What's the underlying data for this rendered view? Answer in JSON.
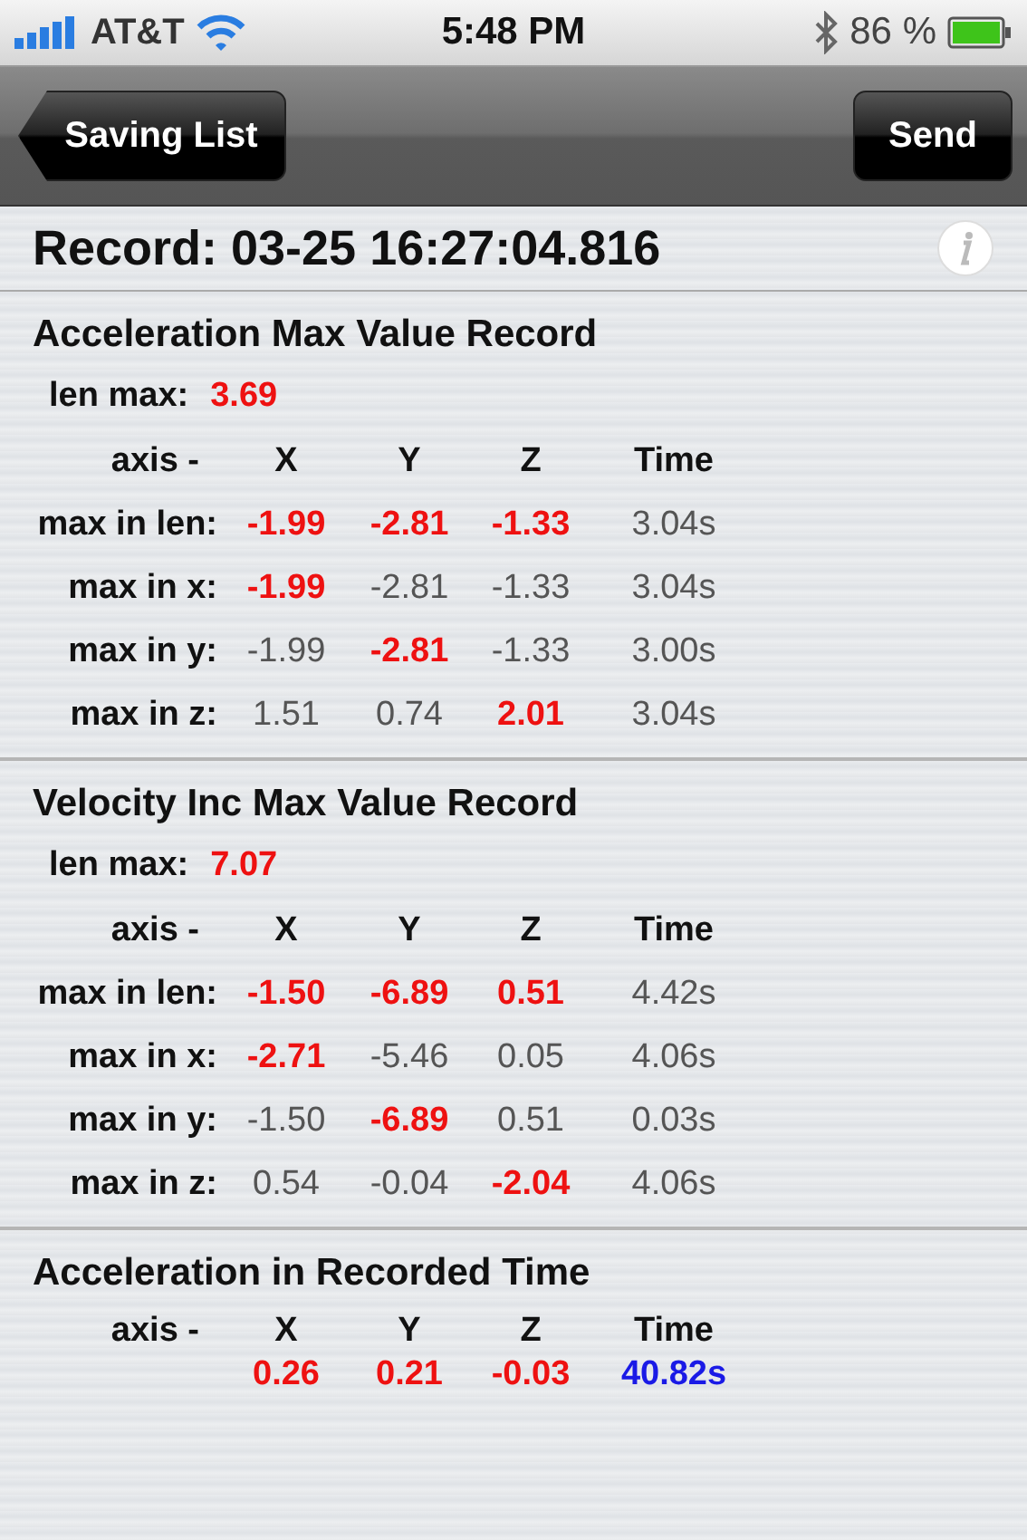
{
  "status_bar": {
    "carrier": "AT&T",
    "time": "5:48 PM",
    "battery": "86 %"
  },
  "nav_bar": {
    "back_button": "Saving List",
    "action_button": "Send"
  },
  "record_title": "Record: 03-25 16:27:04.816",
  "sections": [
    {
      "title": "Acceleration Max Value Record",
      "len_label": "len max:",
      "len_value": "3.69",
      "header": [
        "axis -",
        "X",
        "Y",
        "Z",
        "Time"
      ],
      "rows": [
        {
          "label": "max in len:",
          "cells": [
            {
              "text": "-1.99",
              "highlighted": true
            },
            {
              "text": "-2.81",
              "highlighted": true
            },
            {
              "text": "-1.33",
              "highlighted": true
            },
            {
              "text": "3.04s",
              "highlighted": false
            }
          ]
        },
        {
          "label": "max in x:",
          "cells": [
            {
              "text": "-1.99",
              "highlighted": true
            },
            {
              "text": "-2.81",
              "highlighted": false
            },
            {
              "text": "-1.33",
              "highlighted": false
            },
            {
              "text": "3.04s",
              "highlighted": false
            }
          ]
        },
        {
          "label": "max in y:",
          "cells": [
            {
              "text": "-1.99",
              "highlighted": false
            },
            {
              "text": "-2.81",
              "highlighted": true
            },
            {
              "text": "-1.33",
              "highlighted": false
            },
            {
              "text": "3.00s",
              "highlighted": false
            }
          ]
        },
        {
          "label": "max in z:",
          "cells": [
            {
              "text": "1.51",
              "highlighted": false
            },
            {
              "text": "0.74",
              "highlighted": false
            },
            {
              "text": "2.01",
              "highlighted": true
            },
            {
              "text": "3.04s",
              "highlighted": false
            }
          ]
        }
      ]
    },
    {
      "title": "Velocity Inc Max Value Record",
      "len_label": "len max:",
      "len_value": "7.07",
      "header": [
        "axis -",
        "X",
        "Y",
        "Z",
        "Time"
      ],
      "rows": [
        {
          "label": "max in len:",
          "cells": [
            {
              "text": "-1.50",
              "highlighted": true
            },
            {
              "text": "-6.89",
              "highlighted": true
            },
            {
              "text": "0.51",
              "highlighted": true
            },
            {
              "text": "4.42s",
              "highlighted": false
            }
          ]
        },
        {
          "label": "max in x:",
          "cells": [
            {
              "text": "-2.71",
              "highlighted": true
            },
            {
              "text": "-5.46",
              "highlighted": false
            },
            {
              "text": "0.05",
              "highlighted": false
            },
            {
              "text": "4.06s",
              "highlighted": false
            }
          ]
        },
        {
          "label": "max in y:",
          "cells": [
            {
              "text": "-1.50",
              "highlighted": false
            },
            {
              "text": "-6.89",
              "highlighted": true
            },
            {
              "text": "0.51",
              "highlighted": false
            },
            {
              "text": "0.03s",
              "highlighted": false
            }
          ]
        },
        {
          "label": "max in z:",
          "cells": [
            {
              "text": "0.54",
              "highlighted": false
            },
            {
              "text": "-0.04",
              "highlighted": false
            },
            {
              "text": "-2.04",
              "highlighted": true
            },
            {
              "text": "4.06s",
              "highlighted": false
            }
          ]
        }
      ]
    }
  ],
  "recorded": {
    "title": "Acceleration in Recorded Time",
    "header": [
      "axis -",
      "X",
      "Y",
      "Z",
      "Time"
    ],
    "cells": [
      {
        "text": "0.26",
        "highlighted": true
      },
      {
        "text": "0.21",
        "highlighted": true
      },
      {
        "text": "-0.03",
        "highlighted": true
      },
      {
        "text": "40.82s",
        "highlighted": true
      }
    ]
  }
}
